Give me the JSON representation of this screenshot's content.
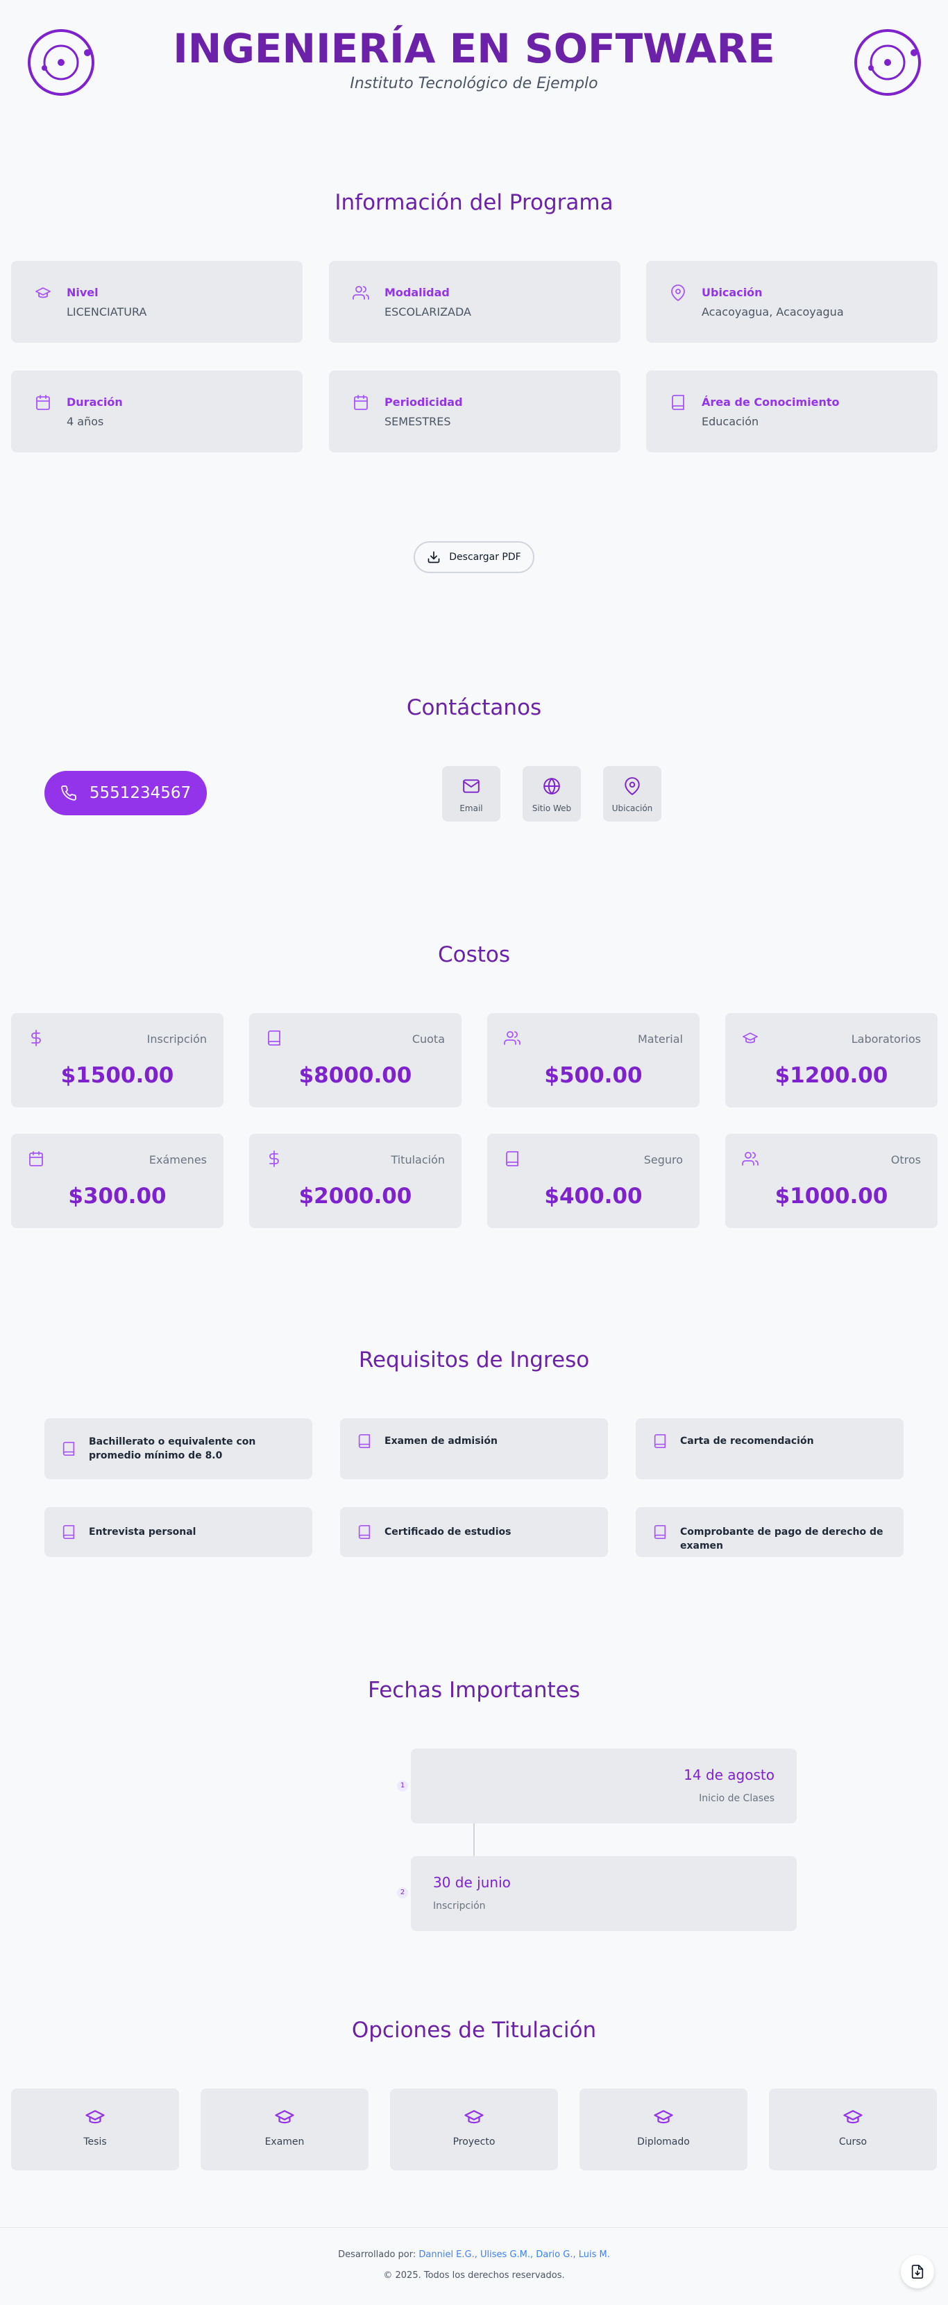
{
  "colors": {
    "brand": "#6b21a8",
    "accent": "#9333ea",
    "card_bg": "#e8eaee",
    "link": "#3b82f6"
  },
  "header": {
    "title": "INGENIERÍA EN SOFTWARE",
    "subtitle": "Instituto Tecnológico de Ejemplo",
    "logo_icon": "orbit-logo-icon"
  },
  "program": {
    "title": "Información del Programa",
    "items": [
      {
        "icon": "graduation-cap-icon",
        "label": "Nivel",
        "value": "LICENCIATURA"
      },
      {
        "icon": "users-icon",
        "label": "Modalidad",
        "value": "ESCOLARIZADA"
      },
      {
        "icon": "map-pin-icon",
        "label": "Ubicación",
        "value": "Acacoyagua, Acacoyagua"
      },
      {
        "icon": "calendar-icon",
        "label": "Duración",
        "value": "4 años"
      },
      {
        "icon": "calendar-icon",
        "label": "Periodicidad",
        "value": "SEMESTRES"
      },
      {
        "icon": "book-icon",
        "label": "Área de Conocimiento",
        "value": "Educación"
      }
    ],
    "download_label": "Descargar PDF"
  },
  "contact": {
    "title": "Contáctanos",
    "phone": "5551234567",
    "tiles": [
      {
        "icon": "mail-icon",
        "label": "Email"
      },
      {
        "icon": "globe-icon",
        "label": "Sitio Web"
      },
      {
        "icon": "map-pin-icon",
        "label": "Ubicación"
      }
    ]
  },
  "costs": {
    "title": "Costos",
    "items": [
      {
        "icon": "dollar-icon",
        "label": "Inscripción",
        "amount": "$1500.00"
      },
      {
        "icon": "book-icon",
        "label": "Cuota",
        "amount": "$8000.00"
      },
      {
        "icon": "users-icon",
        "label": "Material",
        "amount": "$500.00"
      },
      {
        "icon": "graduation-cap-icon",
        "label": "Laboratorios",
        "amount": "$1200.00"
      },
      {
        "icon": "calendar-icon",
        "label": "Exámenes",
        "amount": "$300.00"
      },
      {
        "icon": "dollar-icon",
        "label": "Titulación",
        "amount": "$2000.00"
      },
      {
        "icon": "book-icon",
        "label": "Seguro",
        "amount": "$400.00"
      },
      {
        "icon": "users-icon",
        "label": "Otros",
        "amount": "$1000.00"
      }
    ]
  },
  "requirements": {
    "title": "Requisitos de Ingreso",
    "items": [
      "Bachillerato o equivalente con promedio mínimo de 8.0",
      "Examen de admisión",
      "Carta de recomendación",
      "Entrevista personal",
      "Certificado de estudios",
      "Comprobante de pago de derecho de examen"
    ]
  },
  "dates": {
    "title": "Fechas Importantes",
    "items": [
      {
        "number": "1",
        "date": "14 de agosto",
        "event": "Inicio de Clases"
      },
      {
        "number": "2",
        "date": "30 de junio",
        "event": "Inscripción"
      }
    ]
  },
  "titling": {
    "title": "Opciones de Titulación",
    "options": [
      "Tesis",
      "Examen",
      "Proyecto",
      "Diplomado",
      "Curso"
    ]
  },
  "footer": {
    "developed_by": "Desarrollado por:",
    "authors": "Danniel E.G., Ulises G.M., Dario G., Luis M.",
    "copyright": "© 2025. Todos los derechos reservados.",
    "fab_icon": "file-download-icon"
  }
}
